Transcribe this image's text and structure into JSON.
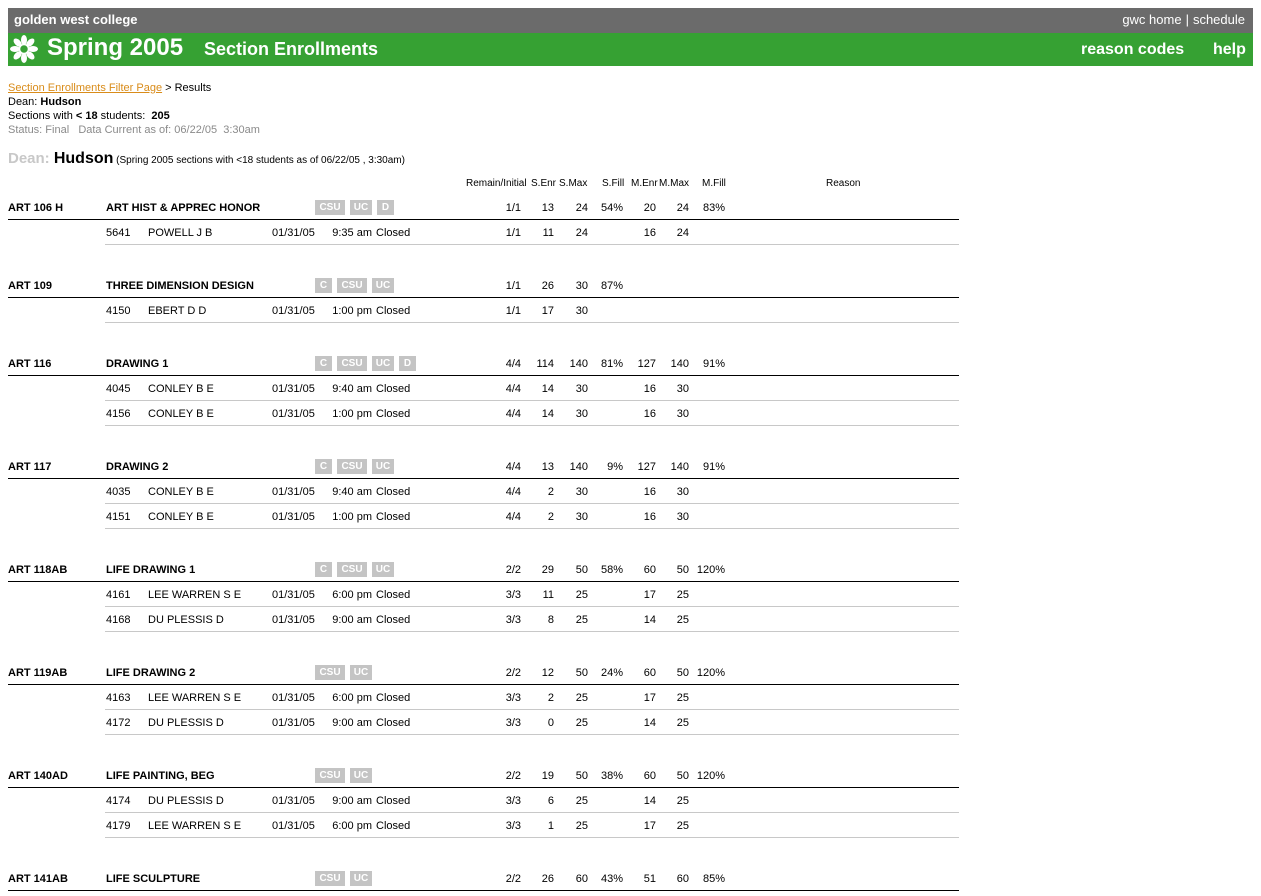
{
  "header": {
    "site_name": "golden west college",
    "link_home": "gwc home",
    "link_sep": "|",
    "link_schedule": "schedule",
    "term": "Spring 2005",
    "title": "Section Enrollments",
    "reason_codes": "reason codes",
    "help": "help",
    "logo_icon": "sun-flower-icon"
  },
  "breadcrumb": {
    "link": "Section Enrollments Filter Page",
    "current": " > Results"
  },
  "filters": {
    "dean_label": "Dean: ",
    "dean_value": "Hudson",
    "sections_label_pre": "Sections with ",
    "sections_threshold": "< 18",
    "sections_label_post": " students:  ",
    "sections_count": "205",
    "status": "Status: Final",
    "data_current": "Data Current as of: 06/22/05  3:30am"
  },
  "report_title": {
    "dean_label": "Dean: ",
    "dean_name": "Hudson",
    "subtitle": " (Spring 2005 sections with <18 students as of 06/22/05 , 3:30am)"
  },
  "columns": {
    "remain": "Remain/Initial",
    "senr": "S.Enr",
    "smax": "S.Max",
    "sfill": "S.Fill",
    "menr": "M.Enr",
    "mmax": "M.Max",
    "mfill": "M.Fill",
    "reason": "Reason"
  },
  "courses": [
    {
      "code": "ART 106 H",
      "title": "ART HIST & APPREC HONOR",
      "badges": [
        "CSU",
        "UC",
        "D"
      ],
      "remain": "1/1",
      "senr": "13",
      "smax": "24",
      "sfill": "54%",
      "menr": "20",
      "mmax": "24",
      "mfill": "83%",
      "sections": [
        {
          "id": "5641",
          "instructor": "POWELL J B",
          "date": "01/31/05",
          "time": "9:35 am",
          "status": "Closed",
          "remain": "1/1",
          "senr": "11",
          "smax": "24",
          "menr": "16",
          "mmax": "24"
        }
      ]
    },
    {
      "code": "ART 109",
      "title": "THREE DIMENSION DESIGN",
      "badges": [
        "C",
        "CSU",
        "UC"
      ],
      "remain": "1/1",
      "senr": "26",
      "smax": "30",
      "sfill": "87%",
      "menr": "",
      "mmax": "",
      "mfill": "",
      "sections": [
        {
          "id": "4150",
          "instructor": "EBERT D D",
          "date": "01/31/05",
          "time": "1:00 pm",
          "status": "Closed",
          "remain": "1/1",
          "senr": "17",
          "smax": "30",
          "menr": "",
          "mmax": ""
        }
      ]
    },
    {
      "code": "ART 116",
      "title": "DRAWING 1",
      "badges": [
        "C",
        "CSU",
        "UC",
        "D"
      ],
      "remain": "4/4",
      "senr": "114",
      "smax": "140",
      "sfill": "81%",
      "menr": "127",
      "mmax": "140",
      "mfill": "91%",
      "sections": [
        {
          "id": "4045",
          "instructor": "CONLEY B E",
          "date": "01/31/05",
          "time": "9:40 am",
          "status": "Closed",
          "remain": "4/4",
          "senr": "14",
          "smax": "30",
          "menr": "16",
          "mmax": "30"
        },
        {
          "id": "4156",
          "instructor": "CONLEY B E",
          "date": "01/31/05",
          "time": "1:00 pm",
          "status": "Closed",
          "remain": "4/4",
          "senr": "14",
          "smax": "30",
          "menr": "16",
          "mmax": "30"
        }
      ]
    },
    {
      "code": "ART 117",
      "title": "DRAWING 2",
      "badges": [
        "C",
        "CSU",
        "UC"
      ],
      "remain": "4/4",
      "senr": "13",
      "smax": "140",
      "sfill": "9%",
      "menr": "127",
      "mmax": "140",
      "mfill": "91%",
      "sections": [
        {
          "id": "4035",
          "instructor": "CONLEY B E",
          "date": "01/31/05",
          "time": "9:40 am",
          "status": "Closed",
          "remain": "4/4",
          "senr": "2",
          "smax": "30",
          "menr": "16",
          "mmax": "30"
        },
        {
          "id": "4151",
          "instructor": "CONLEY B E",
          "date": "01/31/05",
          "time": "1:00 pm",
          "status": "Closed",
          "remain": "4/4",
          "senr": "2",
          "smax": "30",
          "menr": "16",
          "mmax": "30"
        }
      ]
    },
    {
      "code": "ART 118AB",
      "title": "LIFE DRAWING 1",
      "badges": [
        "C",
        "CSU",
        "UC"
      ],
      "remain": "2/2",
      "senr": "29",
      "smax": "50",
      "sfill": "58%",
      "menr": "60",
      "mmax": "50",
      "mfill": "120%",
      "sections": [
        {
          "id": "4161",
          "instructor": "LEE WARREN S E",
          "date": "01/31/05",
          "time": "6:00 pm",
          "status": "Closed",
          "remain": "3/3",
          "senr": "11",
          "smax": "25",
          "menr": "17",
          "mmax": "25"
        },
        {
          "id": "4168",
          "instructor": "DU PLESSIS D",
          "date": "01/31/05",
          "time": "9:00 am",
          "status": "Closed",
          "remain": "3/3",
          "senr": "8",
          "smax": "25",
          "menr": "14",
          "mmax": "25"
        }
      ]
    },
    {
      "code": "ART 119AB",
      "title": "LIFE DRAWING 2",
      "badges": [
        "CSU",
        "UC"
      ],
      "remain": "2/2",
      "senr": "12",
      "smax": "50",
      "sfill": "24%",
      "menr": "60",
      "mmax": "50",
      "mfill": "120%",
      "sections": [
        {
          "id": "4163",
          "instructor": "LEE WARREN S E",
          "date": "01/31/05",
          "time": "6:00 pm",
          "status": "Closed",
          "remain": "3/3",
          "senr": "2",
          "smax": "25",
          "menr": "17",
          "mmax": "25"
        },
        {
          "id": "4172",
          "instructor": "DU PLESSIS D",
          "date": "01/31/05",
          "time": "9:00 am",
          "status": "Closed",
          "remain": "3/3",
          "senr": "0",
          "smax": "25",
          "menr": "14",
          "mmax": "25"
        }
      ]
    },
    {
      "code": "ART 140AD",
      "title": "LIFE PAINTING, BEG",
      "badges": [
        "CSU",
        "UC"
      ],
      "remain": "2/2",
      "senr": "19",
      "smax": "50",
      "sfill": "38%",
      "menr": "60",
      "mmax": "50",
      "mfill": "120%",
      "sections": [
        {
          "id": "4174",
          "instructor": "DU PLESSIS D",
          "date": "01/31/05",
          "time": "9:00 am",
          "status": "Closed",
          "remain": "3/3",
          "senr": "6",
          "smax": "25",
          "menr": "14",
          "mmax": "25"
        },
        {
          "id": "4179",
          "instructor": "LEE WARREN S E",
          "date": "01/31/05",
          "time": "6:00 pm",
          "status": "Closed",
          "remain": "3/3",
          "senr": "1",
          "smax": "25",
          "menr": "17",
          "mmax": "25"
        }
      ]
    },
    {
      "code": "ART 141AB",
      "title": "LIFE SCULPTURE",
      "badges": [
        "CSU",
        "UC"
      ],
      "remain": "2/2",
      "senr": "26",
      "smax": "60",
      "sfill": "43%",
      "menr": "51",
      "mmax": "60",
      "mfill": "85%",
      "sections": []
    }
  ]
}
